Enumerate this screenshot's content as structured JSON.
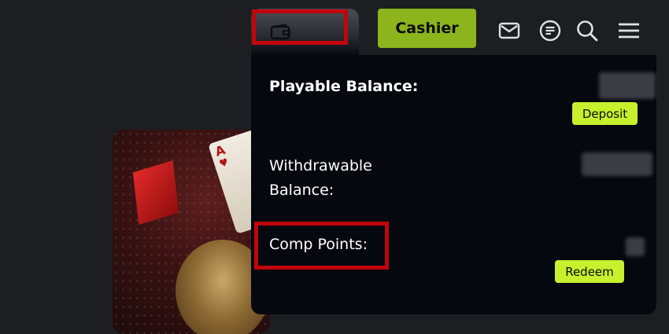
{
  "header": {
    "wallet_icon": "wallet-icon",
    "cashier_label": "Cashier",
    "icons": [
      "mail-icon",
      "chat-icon",
      "search-icon",
      "menu-icon"
    ]
  },
  "balance_panel": {
    "playable_label": "Playable Balance:",
    "deposit_label": "Deposit",
    "withdrawable_line1": "Withdrawable",
    "withdrawable_line2": "Balance:",
    "comp_points_label": "Comp Points:",
    "redeem_label": "Redeem"
  },
  "promo_card": {
    "card_rank": "A",
    "card_suit": "♥"
  },
  "colors": {
    "background": "#1c1e22",
    "cashier_green": "#8cb41c",
    "action_lime": "#c6f12c",
    "highlight_red": "#c0060b",
    "panel_bg": "#05080f"
  }
}
